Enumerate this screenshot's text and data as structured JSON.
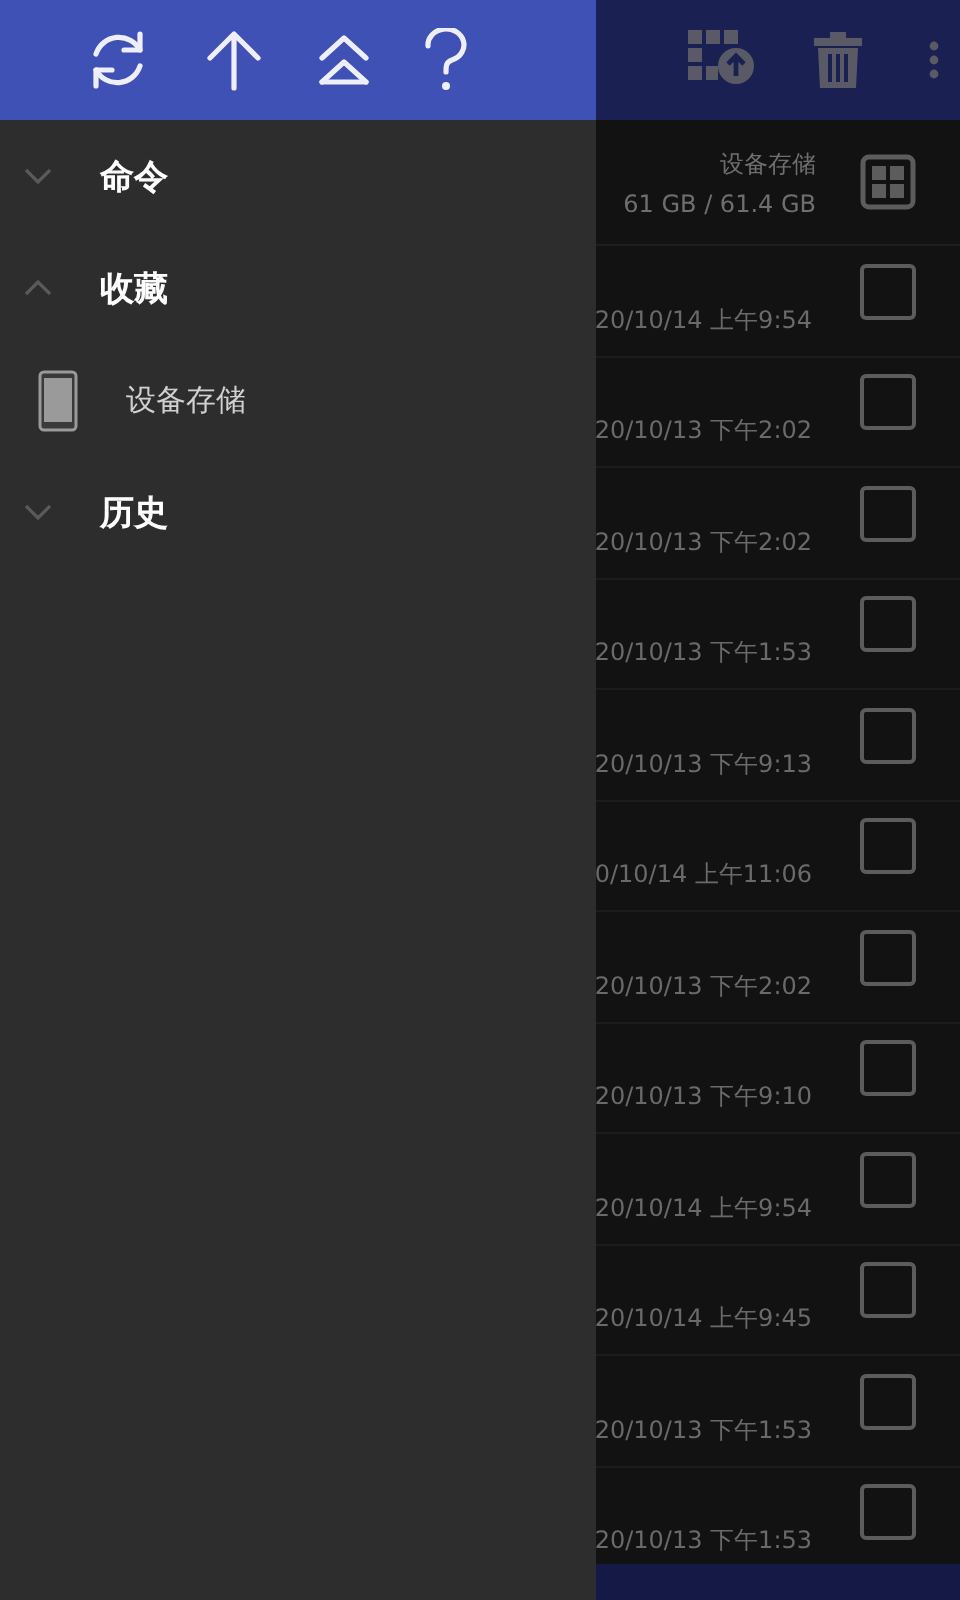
{
  "drawer": {
    "groups": [
      {
        "label": "命令",
        "expanded": false
      },
      {
        "label": "收藏",
        "expanded": true,
        "children": [
          {
            "label": "设备存储"
          }
        ]
      },
      {
        "label": "历史",
        "expanded": false
      }
    ]
  },
  "storage": {
    "name": "设备存储",
    "usage": "61 GB / 61.4 GB"
  },
  "files": [
    {
      "date": "20/10/14 上午9:54",
      "checked": false
    },
    {
      "date": "20/10/13 下午2:02",
      "checked": false
    },
    {
      "date": "20/10/13 下午2:02",
      "checked": false
    },
    {
      "date": "20/10/13 下午1:53",
      "checked": false
    },
    {
      "date": "20/10/13 下午9:13",
      "checked": false
    },
    {
      "date": "0/10/14 上午11:06",
      "checked": false
    },
    {
      "date": "20/10/13 下午2:02",
      "checked": false
    },
    {
      "date": "20/10/13 下午9:10",
      "checked": false
    },
    {
      "date": "20/10/14 上午9:54",
      "checked": false
    },
    {
      "date": "20/10/14 上午9:45",
      "checked": false
    },
    {
      "date": "20/10/13 下午1:53",
      "checked": false
    },
    {
      "date": "20/10/13 下午1:53",
      "checked": false
    }
  ]
}
